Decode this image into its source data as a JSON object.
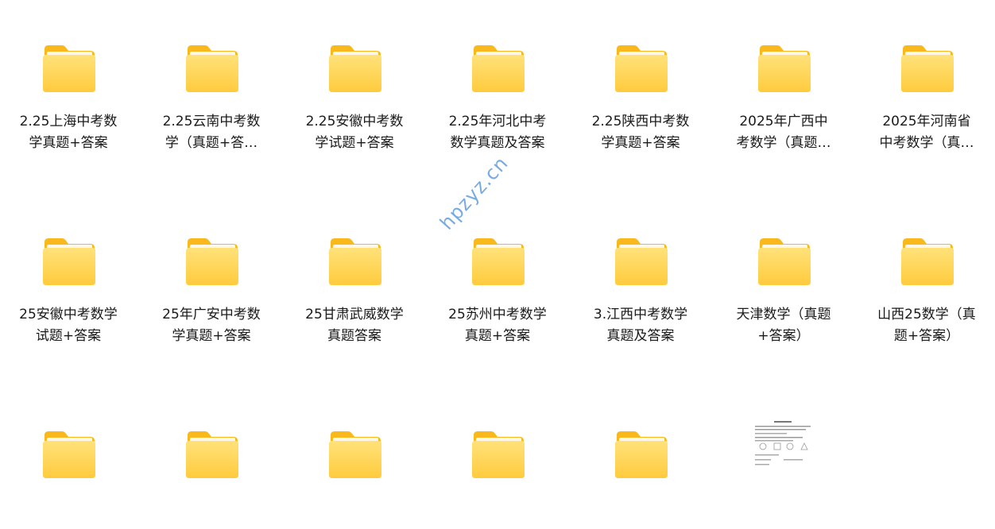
{
  "watermark": "hpzyz.cn",
  "colors": {
    "folder_back": "#F9B81C",
    "folder_front_top": "#FFE27A",
    "folder_front_bottom": "#FFCB3D",
    "label_text": "#1a1a1a",
    "watermark": "#4a90d9"
  },
  "items": [
    {
      "line1": "2.25上海中考数",
      "line2": "学真题+答案",
      "icon": "folder-icon"
    },
    {
      "line1": "2.25云南中考数",
      "line2": "学（真题+答…",
      "icon": "folder-icon"
    },
    {
      "line1": "2.25安徽中考数",
      "line2": "学试题+答案",
      "icon": "folder-icon"
    },
    {
      "line1": "2.25年河北中考",
      "line2": "数学真题及答案",
      "icon": "folder-icon"
    },
    {
      "line1": "2.25陕西中考数",
      "line2": "学真题+答案",
      "icon": "folder-icon"
    },
    {
      "line1": "2025年广西中",
      "line2": "考数学（真题…",
      "icon": "folder-icon"
    },
    {
      "line1": "2025年河南省",
      "line2": "中考数学（真…",
      "icon": "folder-icon"
    },
    {
      "line1": "25安徽中考数学",
      "line2": "试题+答案",
      "icon": "folder-icon"
    },
    {
      "line1": "25年广安中考数",
      "line2": "学真题+答案",
      "icon": "folder-icon"
    },
    {
      "line1": "25甘肃武威数学",
      "line2": "真题答案",
      "icon": "folder-icon"
    },
    {
      "line1": "25苏州中考数学",
      "line2": "真题+答案",
      "icon": "folder-icon"
    },
    {
      "line1": "3.江西中考数学",
      "line2": "真题及答案",
      "icon": "folder-icon"
    },
    {
      "line1": "天津数学（真题",
      "line2": "+答案）",
      "icon": "folder-icon"
    },
    {
      "line1": "山西25数学（真",
      "line2": "题+答案）",
      "icon": "folder-icon"
    },
    {
      "line1": "",
      "line2": "",
      "icon": "folder-icon"
    },
    {
      "line1": "",
      "line2": "",
      "icon": "folder-icon"
    },
    {
      "line1": "",
      "line2": "",
      "icon": "folder-icon"
    },
    {
      "line1": "",
      "line2": "",
      "icon": "folder-icon"
    },
    {
      "line1": "",
      "line2": "",
      "icon": "folder-icon"
    }
  ],
  "document_thumbnail": {
    "icon": "document-thumbnail-icon"
  }
}
